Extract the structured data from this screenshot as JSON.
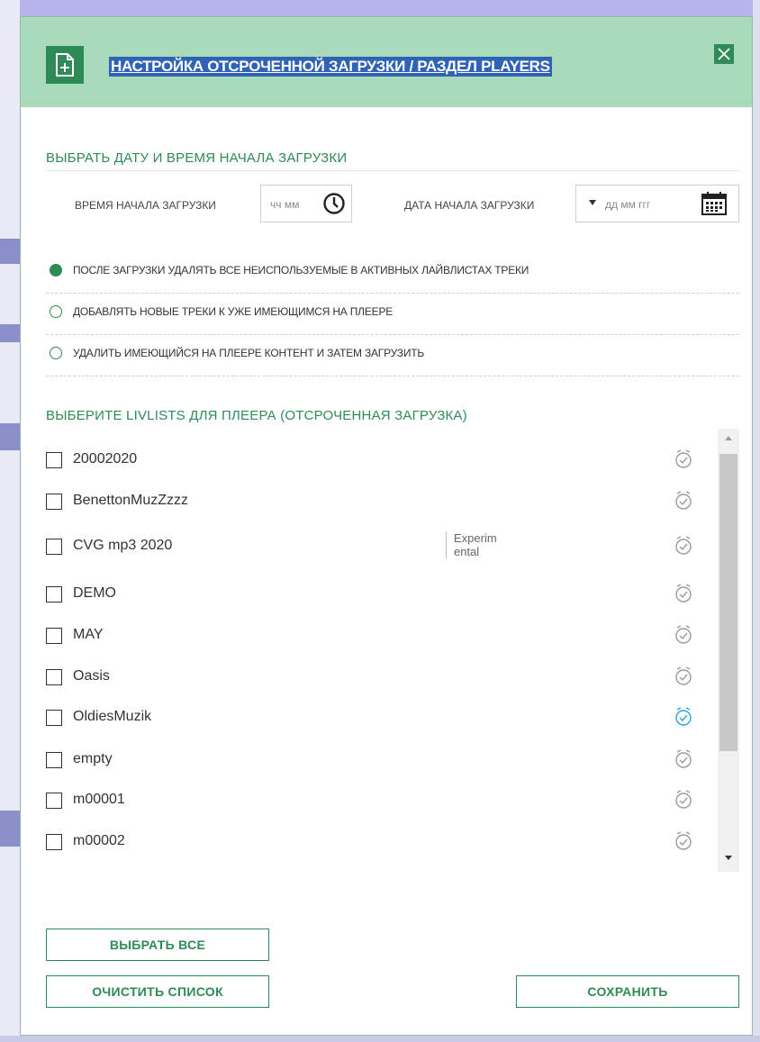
{
  "dialog": {
    "title": "НАСТРОЙКА ОТСРОЧЕННОЙ ЗАГРУЗКИ / РАЗДЕЛ PLAYERS",
    "icon": "document-plus-icon",
    "close_icon": "close-icon"
  },
  "schedule": {
    "section_title": "ВЫБРАТЬ ДАТУ И ВРЕМЯ НАЧАЛА ЗАГРУЗКИ",
    "time_label": "ВРЕМЯ НАЧАЛА ЗАГРУЗКИ",
    "time_placeholder": "чч мм",
    "date_label": "ДАТА НАЧАЛА ЗАГРУЗКИ",
    "date_placeholder": "дд мм ггг"
  },
  "options": [
    {
      "label": "ПОСЛЕ ЗАГРУЗКИ УДАЛЯТЬ ВСЕ НЕИСПОЛЬЗУЕМЫЕ В АКТИВНЫХ ЛАЙВЛИСТАХ ТРЕКИ",
      "selected": true
    },
    {
      "label": "ДОБАВЛЯТЬ НОВЫЕ ТРЕКИ К УЖЕ ИМЕЮЩИМСЯ НА ПЛЕЕРЕ",
      "selected": false
    },
    {
      "label": "УДАЛИТЬ ИМЕЮЩИЙСЯ НА ПЛЕЕРЕ КОНТЕНТ И ЗАТЕМ ЗАГРУЗИТЬ",
      "selected": false
    }
  ],
  "livlists": {
    "section_title": "ВЫБЕРИТЕ LIVLISTS ДЛЯ ПЛЕЕРА (ОТСРОЧЕННАЯ ЗАГРУЗКА)",
    "items": [
      {
        "name": "20002020",
        "tag": "",
        "alarm_active": false
      },
      {
        "name": "BenettonMuzZzzz",
        "tag": "",
        "alarm_active": false
      },
      {
        "name": "CVG mp3 2020",
        "tag": "Experim ental",
        "alarm_active": false
      },
      {
        "name": "DEMO",
        "tag": "",
        "alarm_active": false
      },
      {
        "name": "MAY",
        "tag": "",
        "alarm_active": false
      },
      {
        "name": "Oasis",
        "tag": "",
        "alarm_active": false
      },
      {
        "name": "OldiesMuzik",
        "tag": "",
        "alarm_active": true
      },
      {
        "name": "empty",
        "tag": "",
        "alarm_active": false
      },
      {
        "name": "m00001",
        "tag": "",
        "alarm_active": false
      },
      {
        "name": "m00002",
        "tag": "",
        "alarm_active": false
      }
    ]
  },
  "buttons": {
    "select_all": "ВЫБРАТЬ ВСЕ",
    "clear_list": "ОЧИСТИТЬ СПИСОК",
    "save": "СОХРАНИТЬ"
  },
  "colors": {
    "accent": "#2e8b57",
    "header_bg": "#a9dbbb",
    "title_highlight": "#2f63b8",
    "alarm_active": "#2aa3d9",
    "alarm_inactive": "#9a9a9a"
  }
}
